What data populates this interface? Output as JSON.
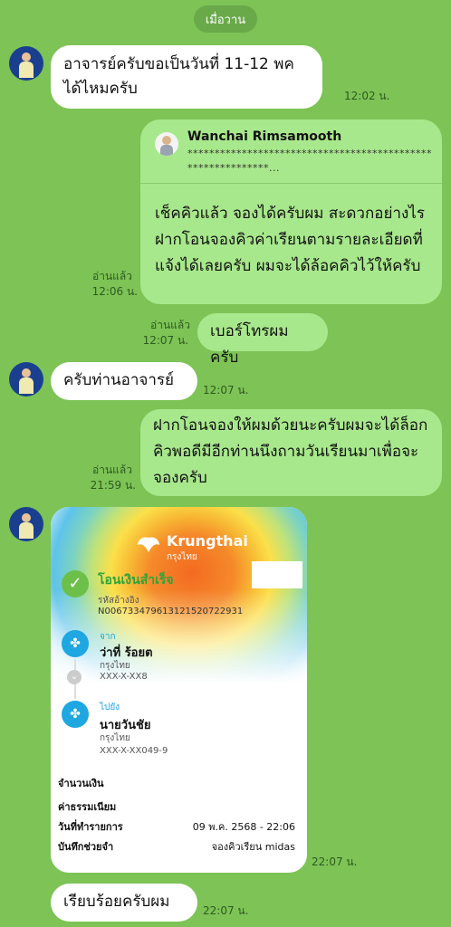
{
  "date_separator": "เมื่อวาน",
  "messages": {
    "m1": {
      "text": "อาจารย์ครับขอเป็นวันที่ 11-12 พค ได้ไหมครับ",
      "time": "12:02 น."
    },
    "m2": {
      "reply_to_name": "Wanchai Rimsamooth",
      "reply_to_preview": "************************************************************...",
      "text": "เช็คคิวแล้ว จองได้ครับผม สะดวกอย่างไรฝากโอนจองคิวค่าเรียนตามรายละเอียดที่แจ้งได้เลยครับ ผมจะได้ล้อคคิวไว้ให้ครับ",
      "read": "อ่านแล้ว",
      "time": "12:06 น."
    },
    "m3": {
      "text": "เบอร์โทรผมครับ",
      "read": "อ่านแล้ว",
      "time": "12:07 น."
    },
    "m4": {
      "text": "ครับท่านอาจารย์",
      "time": "12:07 น."
    },
    "m5": {
      "text": "ฝากโอนจองให้ผมด้วยนะครับผมจะได้ล็อกคิวพอดีมีอีกท่านนึงถามวันเรียนมาเพื่อจะจองครับ",
      "read": "อ่านแล้ว",
      "time": "21:59 น."
    },
    "m6": {
      "time": "22:07 น."
    },
    "m7": {
      "text": "เรียบร้อยครับผม",
      "time": "22:07 น."
    }
  },
  "slip": {
    "bank_name": "Krungthai",
    "bank_name_th": "กรุงไทย",
    "status": "โอนเงินสำเร็จ",
    "ref_label": "รหัสอ้างอิง",
    "ref_no": "N006733479613121520722931",
    "from_label": "จาก",
    "from_name": "ว่าที่ ร้อยต",
    "from_bank": "กรุงไทย",
    "from_acct": "XXX-X-XX8",
    "to_label": "ไปยัง",
    "to_name": "นายวันชัย",
    "to_bank": "กรุงไทย",
    "to_acct": "XXX-X-XX049-9",
    "amount_label": "จำนวนเงิน",
    "fee_label": "ค่าธรรมเนียม",
    "date_label": "วันที่ทำรายการ",
    "date_value": "09 พ.ค. 2568 - 22:06",
    "memo_label": "บันทึกช่วยจำ",
    "memo_value": "จองคิวเรียน midas"
  },
  "colors": {
    "background": "#7dc356",
    "bubble_out": "#a8e88c",
    "bubble_in": "#ffffff",
    "success": "#2ea43c",
    "bank_blue": "#1ea7e0"
  }
}
